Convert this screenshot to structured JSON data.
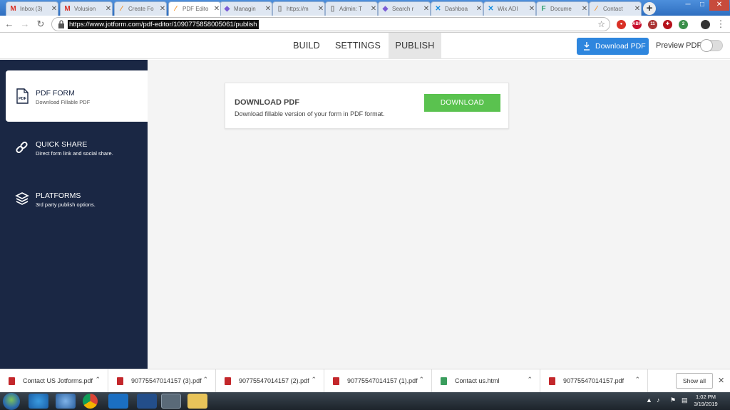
{
  "browser": {
    "tabs": [
      {
        "title": "Inbox (3)",
        "icon": "gmail-icon",
        "glyph": "M",
        "color": "#d93025"
      },
      {
        "title": "Volusion",
        "icon": "gmail-icon",
        "glyph": "M",
        "color": "#d93025"
      },
      {
        "title": "Create Fo",
        "icon": "jotform-icon",
        "glyph": "⁄",
        "color": "#f38b1b"
      },
      {
        "title": "PDF Edito",
        "icon": "jotform-icon",
        "glyph": "⁄",
        "color": "#f38b1b"
      },
      {
        "title": "Managin",
        "icon": "diamond-icon",
        "glyph": "◆",
        "color": "#7b5cd6"
      },
      {
        "title": "https://m",
        "icon": "page-icon",
        "glyph": "▯",
        "color": "#777"
      },
      {
        "title": "Admin: T",
        "icon": "page-icon",
        "glyph": "▯",
        "color": "#777"
      },
      {
        "title": "Search r",
        "icon": "diamond-icon",
        "glyph": "◆",
        "color": "#7b5cd6"
      },
      {
        "title": "Dashboa",
        "icon": "wix-icon",
        "glyph": "✕",
        "color": "#1a8fe0"
      },
      {
        "title": "Wix ADI",
        "icon": "wix-icon",
        "glyph": "✕",
        "color": "#1a8fe0"
      },
      {
        "title": "Docume",
        "icon": "fb-icon",
        "glyph": "F",
        "color": "#2f9e6e"
      },
      {
        "title": "Contact",
        "icon": "jotform-icon",
        "glyph": "⁄",
        "color": "#f38b1b"
      }
    ],
    "active_tab_index": 3,
    "url": "https://www.jotform.com/pdf-editor/1090775858005061/publish",
    "ext_badges": [
      "ABP",
      "11",
      "2"
    ]
  },
  "header": {
    "tabs": [
      "BUILD",
      "SETTINGS",
      "PUBLISH"
    ],
    "active_tab": "PUBLISH",
    "download_button": "Download PDF",
    "preview_label": "Preview PDF",
    "preview_enabled": false
  },
  "sidebar": {
    "items": [
      {
        "title": "PDF FORM",
        "desc": "Download Fillable PDF",
        "icon": "pdf-icon",
        "active": true
      },
      {
        "title": "QUICK SHARE",
        "desc": "Direct form link and social share.",
        "icon": "link-icon",
        "active": false
      },
      {
        "title": "PLATFORMS",
        "desc": "3rd party publish options.",
        "icon": "layers-icon",
        "active": false
      }
    ]
  },
  "card": {
    "title": "DOWNLOAD PDF",
    "desc": "Download fillable version of your form in PDF format.",
    "button": "DOWNLOAD"
  },
  "downloads": {
    "items": [
      "Contact US Jotforms.pdf",
      "90775547014157 (3).pdf",
      "90775547014157 (2).pdf",
      "90775547014157 (1).pdf",
      "Contact us.html",
      "90775547014157.pdf"
    ],
    "show_all": "Show all"
  },
  "taskbar": {
    "time": "1:02 PM",
    "date": "3/19/2019"
  },
  "colors": {
    "sidebar": "#1a2744",
    "accent_blue": "#2e86de",
    "download_green": "#5ac24f"
  }
}
